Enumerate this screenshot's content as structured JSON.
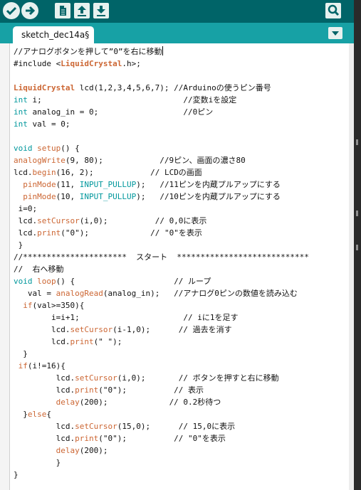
{
  "toolbar": {
    "buttons": [
      {
        "name": "verify-button",
        "icon": "check-icon"
      },
      {
        "name": "upload-button",
        "icon": "arrow-right-icon"
      },
      {
        "name": "new-button",
        "icon": "file-icon"
      },
      {
        "name": "open-button",
        "icon": "arrow-up-icon"
      },
      {
        "name": "save-button",
        "icon": "arrow-down-icon"
      }
    ],
    "serial_monitor_icon": "magnifier-icon"
  },
  "tab": {
    "label": "sketch_dec14a§"
  },
  "colors": {
    "toolbar_bg": "#006468",
    "tabbar_bg": "#17a1a5",
    "keyword": "#cc6633",
    "type": "#00979c",
    "comment": "#95a5a6"
  },
  "code_lines": [
    [
      {
        "t": "//アナログボタンを押して”0”を右に移動"
      },
      {
        "cursor": true
      }
    ],
    [
      {
        "t": "#include <"
      },
      {
        "t": "LiquidCrystal",
        "c": "cls"
      },
      {
        "t": ".h>;"
      }
    ],
    [],
    [
      {
        "t": "LiquidCrystal",
        "c": "cls"
      },
      {
        "t": " lcd(1,2,3,4,5,6,7); //Arduinoの使うピン番号"
      }
    ],
    [
      {
        "t": "int",
        "c": "ty"
      },
      {
        "t": " i;                              //変数iを設定"
      }
    ],
    [
      {
        "t": "int",
        "c": "ty"
      },
      {
        "t": " analog_in = 0;                  //0ピン"
      }
    ],
    [
      {
        "t": "int",
        "c": "ty"
      },
      {
        "t": " val = 0;"
      }
    ],
    [],
    [
      {
        "t": "void",
        "c": "ty"
      },
      {
        "t": " "
      },
      {
        "t": "setup",
        "c": "kw"
      },
      {
        "t": "() {"
      }
    ],
    [
      {
        "t": "analogWrite",
        "c": "kw"
      },
      {
        "t": "(9, 80);            //9ピン、画面の濃さ80"
      }
    ],
    [
      {
        "t": "lcd."
      },
      {
        "t": "begin",
        "c": "kw"
      },
      {
        "t": "(16, 2);            // LCDの画面"
      }
    ],
    [
      {
        "t": "  "
      },
      {
        "t": "pinMode",
        "c": "kw"
      },
      {
        "t": "(11, "
      },
      {
        "t": "INPUT_PULLUP",
        "c": "ty"
      },
      {
        "t": ");   //11ピンを内蔵プルアップにする"
      }
    ],
    [
      {
        "t": "  "
      },
      {
        "t": "pinMode",
        "c": "kw"
      },
      {
        "t": "(10, "
      },
      {
        "t": "INPUT_PULLUP",
        "c": "ty"
      },
      {
        "t": ");   //10ピンを内蔵プルアップにする"
      }
    ],
    [
      {
        "t": " i=0;"
      }
    ],
    [
      {
        "t": " lcd."
      },
      {
        "t": "setCursor",
        "c": "kw"
      },
      {
        "t": "(i,0);          // 0,0に表示"
      }
    ],
    [
      {
        "t": " lcd."
      },
      {
        "t": "print",
        "c": "kw"
      },
      {
        "t": "(\"0\");             // \"0\"を表示"
      }
    ],
    [
      {
        "t": " }"
      }
    ],
    [
      {
        "t": "//**********************  スタート  ****************************"
      }
    ],
    [
      {
        "t": "//  右へ移動"
      }
    ],
    [
      {
        "t": "void",
        "c": "ty"
      },
      {
        "t": " "
      },
      {
        "t": "loop",
        "c": "kw"
      },
      {
        "t": "() {                     // ループ"
      }
    ],
    [
      {
        "t": "   val = "
      },
      {
        "t": "analogRead",
        "c": "kw"
      },
      {
        "t": "(analog_in);   //アナログ0ピンの数値を読み込む"
      }
    ],
    [
      {
        "t": "  "
      },
      {
        "t": "if",
        "c": "kw"
      },
      {
        "t": "(val>=350){"
      }
    ],
    [
      {
        "t": "        i=i+1;                      // iに1を足す"
      }
    ],
    [
      {
        "t": "        lcd."
      },
      {
        "t": "setCursor",
        "c": "kw"
      },
      {
        "t": "(i-1,0);      // 過去を消す"
      }
    ],
    [
      {
        "t": "        lcd."
      },
      {
        "t": "print",
        "c": "kw"
      },
      {
        "t": "(\" \");"
      }
    ],
    [
      {
        "t": "  }"
      }
    ],
    [
      {
        "t": " "
      },
      {
        "t": "if",
        "c": "kw"
      },
      {
        "t": "(i!=16){"
      }
    ],
    [
      {
        "t": "         lcd."
      },
      {
        "t": "setCursor",
        "c": "kw"
      },
      {
        "t": "(i,0);       // ボタンを押すと右に移動"
      }
    ],
    [
      {
        "t": "         lcd."
      },
      {
        "t": "print",
        "c": "kw"
      },
      {
        "t": "(\"0\");          // 表示"
      }
    ],
    [
      {
        "t": "         "
      },
      {
        "t": "delay",
        "c": "kw"
      },
      {
        "t": "(200);             // 0.2秒待つ"
      }
    ],
    [
      {
        "t": "  }"
      },
      {
        "t": "else",
        "c": "kw"
      },
      {
        "t": "{"
      }
    ],
    [
      {
        "t": "         lcd."
      },
      {
        "t": "setCursor",
        "c": "kw"
      },
      {
        "t": "(15,0);      // 15,0に表示"
      }
    ],
    [
      {
        "t": "         lcd."
      },
      {
        "t": "print",
        "c": "kw"
      },
      {
        "t": "(\"0\");          // \"0\"を表示"
      }
    ],
    [
      {
        "t": "         "
      },
      {
        "t": "delay",
        "c": "kw"
      },
      {
        "t": "(200);"
      }
    ],
    [
      {
        "t": "         }"
      }
    ],
    [
      {
        "t": "}"
      }
    ]
  ]
}
